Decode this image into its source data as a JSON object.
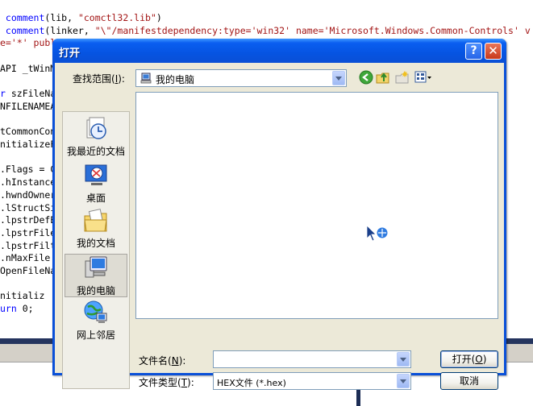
{
  "editor": {
    "lines": [
      {
        "kw": " comment",
        "rest": "(lib, ",
        "str": "\"comctl32.lib\"",
        "tail": ")"
      },
      {
        "kw": " comment",
        "rest": "(linker, ",
        "str": "\"\\\"/manifestdependency:type='win32' name='Microsoft.Windows.Common-Controls' v",
        "tail": ""
      },
      {
        "kw": "",
        "rest": "",
        "str": "e='*' publ",
        "tail": ""
      },
      {
        "kw": "",
        "rest": "",
        "str": "",
        "tail": ""
      },
      {
        "kw": "",
        "rest": "API _tWinM",
        "str": "",
        "tail": ""
      },
      {
        "kw": "",
        "rest": "",
        "str": "",
        "tail": ""
      },
      {
        "kw": "r",
        "rest": " szFileNa",
        "str": "",
        "tail": ""
      },
      {
        "kw": "",
        "rest": "NFILENAMEA",
        "str": "",
        "tail": ""
      },
      {
        "kw": "",
        "rest": "",
        "str": "",
        "tail": ""
      },
      {
        "kw": "",
        "rest": "tCommonCon",
        "str": "",
        "tail": ""
      },
      {
        "kw": "",
        "rest": "nitializeF",
        "str": "",
        "tail": ""
      },
      {
        "kw": "",
        "rest": "",
        "str": "",
        "tail": ""
      },
      {
        "kw": "",
        "rest": ".Flags = C",
        "str": "",
        "tail": ""
      },
      {
        "kw": "",
        "rest": ".hInstance",
        "str": "",
        "tail": ""
      },
      {
        "kw": "",
        "rest": ".hwndOwner",
        "str": "",
        "tail": ""
      },
      {
        "kw": "",
        "rest": ".lStructSi",
        "str": "",
        "tail": ""
      },
      {
        "kw": "",
        "rest": ".lpstrDefE",
        "str": "",
        "tail": ""
      },
      {
        "kw": "",
        "rest": ".lpstrFile",
        "str": "",
        "tail": ""
      },
      {
        "kw": "",
        "rest": ".lpstrFilt",
        "str": "",
        "tail": ""
      },
      {
        "kw": "",
        "rest": ".nMaxFile",
        "str": "",
        "tail": ""
      },
      {
        "kw": "",
        "rest": "OpenFileNa",
        "str": "",
        "tail": ""
      },
      {
        "kw": "",
        "rest": "",
        "str": "",
        "tail": ""
      },
      {
        "kw": "",
        "rest": "nitializ",
        "str": "",
        "tail": ""
      },
      {
        "kw": "urn",
        "rest": " 0;",
        "str": "",
        "tail": ""
      }
    ],
    "right_paren": ")"
  },
  "dialog": {
    "title": "打开",
    "help_glyph": "?",
    "close_glyph": "✕",
    "look_in_label": "查找范围",
    "look_in_accel": "I",
    "look_in_value": "我的电脑",
    "places": [
      {
        "label": "我最近的文档",
        "icon": "recent-documents-icon"
      },
      {
        "label": "桌面",
        "icon": "desktop-icon"
      },
      {
        "label": "我的文档",
        "icon": "my-documents-icon"
      },
      {
        "label": "我的电脑",
        "icon": "my-computer-icon"
      },
      {
        "label": "网上邻居",
        "icon": "network-places-icon"
      }
    ],
    "filename_label": "文件名",
    "filename_accel": "N",
    "filename_value": "",
    "filetype_label": "文件类型",
    "filetype_accel": "T",
    "filetype_value": "HEX文件 (*.hex)",
    "open_label": "打开",
    "open_accel": "O",
    "cancel_label": "取消"
  },
  "colors": {
    "title_blue": "#0654e2",
    "dialog_face": "#ece9d8",
    "code_keyword": "#0000ff",
    "code_string": "#a31515"
  }
}
